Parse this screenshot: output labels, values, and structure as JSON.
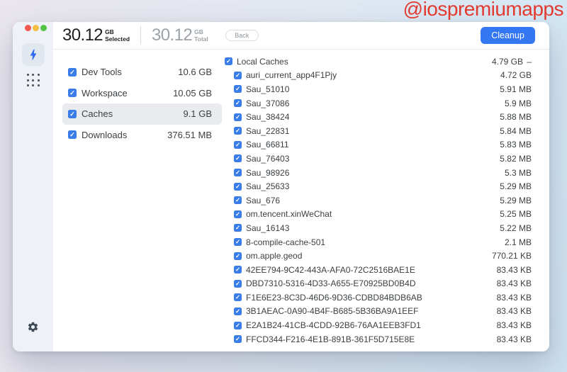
{
  "watermark": "@iospremiumapps",
  "colors": {
    "accent_blue": "#3477f3",
    "checkbox_blue": "#3a7de9",
    "watermark_red": "#e23a30",
    "selected_row_bg": "#e9ebee",
    "sidebar_bg": "#eef2f7"
  },
  "icons": {
    "sidebar_nav": [
      "lightning-icon",
      "apps-grid-icon"
    ],
    "bottom": "gear-icon",
    "checkbox_glyph": "check"
  },
  "header": {
    "selected": {
      "value": "30.12",
      "unit": "GB",
      "label": "Selected"
    },
    "total": {
      "value": "30.12",
      "unit": "GB",
      "label": "Total"
    },
    "back_label": "Back",
    "cleanup_label": "Cleanup"
  },
  "categories": [
    {
      "label": "Dev Tools",
      "size": "10.6 GB",
      "checked": true,
      "selected": false
    },
    {
      "label": "Workspace",
      "size": "10.05 GB",
      "checked": true,
      "selected": false
    },
    {
      "label": "Caches",
      "size": "9.1 GB",
      "checked": true,
      "selected": true
    },
    {
      "label": "Downloads",
      "size": "376.51 MB",
      "checked": true,
      "selected": false
    }
  ],
  "files": [
    {
      "label": "Local Caches",
      "size": "4.79 GB",
      "expand_glyph": "–",
      "indent": 0,
      "checked": true
    },
    {
      "label": "auri_current_app4F1Pjy",
      "size": "4.72 GB",
      "indent": 1,
      "checked": true
    },
    {
      "label": "Sau_51010",
      "size": "5.91 MB",
      "indent": 1,
      "checked": true
    },
    {
      "label": "Sau_37086",
      "size": "5.9 MB",
      "indent": 1,
      "checked": true
    },
    {
      "label": "Sau_38424",
      "size": "5.88 MB",
      "indent": 1,
      "checked": true
    },
    {
      "label": "Sau_22831",
      "size": "5.84 MB",
      "indent": 1,
      "checked": true
    },
    {
      "label": "Sau_66811",
      "size": "5.83 MB",
      "indent": 1,
      "checked": true
    },
    {
      "label": "Sau_76403",
      "size": "5.82 MB",
      "indent": 1,
      "checked": true
    },
    {
      "label": "Sau_98926",
      "size": "5.3 MB",
      "indent": 1,
      "checked": true
    },
    {
      "label": "Sau_25633",
      "size": "5.29 MB",
      "indent": 1,
      "checked": true
    },
    {
      "label": "Sau_676",
      "size": "5.29 MB",
      "indent": 1,
      "checked": true
    },
    {
      "label": "om.tencent.xinWeChat",
      "size": "5.25 MB",
      "indent": 1,
      "checked": true
    },
    {
      "label": "Sau_16143",
      "size": "5.22 MB",
      "indent": 1,
      "checked": true
    },
    {
      "label": "8-compile-cache-501",
      "size": "2.1 MB",
      "indent": 1,
      "checked": true
    },
    {
      "label": "om.apple.geod",
      "size": "770.21 KB",
      "indent": 1,
      "checked": true
    },
    {
      "label": "42EE794-9C42-443A-AFA0-72C2516BAE1E",
      "size": "83.43 KB",
      "indent": 1,
      "checked": true
    },
    {
      "label": "DBD7310-5316-4D33-A655-E70925BD0B4D",
      "size": "83.43 KB",
      "indent": 1,
      "checked": true
    },
    {
      "label": "F1E6E23-8C3D-46D6-9D36-CDBD84BDB6AB",
      "size": "83.43 KB",
      "indent": 1,
      "checked": true
    },
    {
      "label": "3B1AEAC-0A90-4B4F-B685-5B36BA9A1EEF",
      "size": "83.43 KB",
      "indent": 1,
      "checked": true
    },
    {
      "label": "E2A1B24-41CB-4CDD-92B6-76AA1EEB3FD1",
      "size": "83.43 KB",
      "indent": 1,
      "checked": true
    },
    {
      "label": "FFCD344-F216-4E1B-891B-361F5D715E8E",
      "size": "83.43 KB",
      "indent": 1,
      "checked": true
    }
  ]
}
